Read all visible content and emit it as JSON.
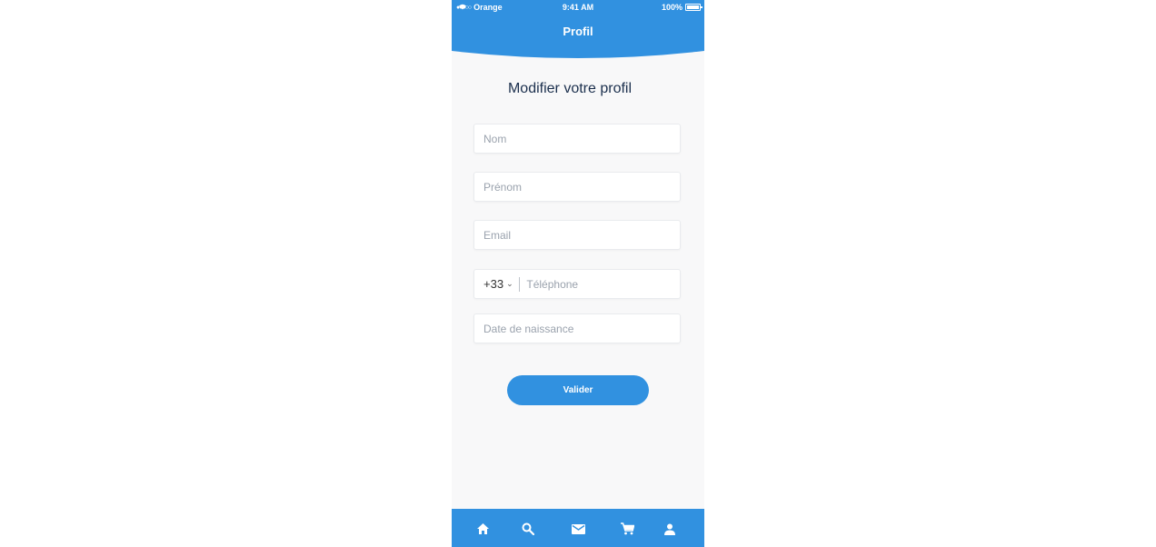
{
  "status_bar": {
    "carrier": "Orange",
    "signal_dots": "●●●○○",
    "time": "9:41 AM",
    "battery": "100%"
  },
  "header": {
    "title": "Profil"
  },
  "main": {
    "heading": "Modifier votre profil",
    "fields": {
      "nom": {
        "placeholder": "Nom",
        "value": ""
      },
      "prenom": {
        "placeholder": "Prénom",
        "value": ""
      },
      "email": {
        "placeholder": "Email",
        "value": ""
      },
      "telephone": {
        "country_code": "+33",
        "placeholder": "Téléphone",
        "value": ""
      },
      "date_naissance": {
        "placeholder": "Date de naissance",
        "value": ""
      }
    },
    "submit_label": "Valider"
  },
  "tabbar": {
    "items": [
      "home-icon",
      "search-icon",
      "mail-icon",
      "cart-icon",
      "profile-icon"
    ]
  },
  "colors": {
    "primary": "#3191e0",
    "heading": "#1b2f4d",
    "background": "#f8f8f9"
  }
}
